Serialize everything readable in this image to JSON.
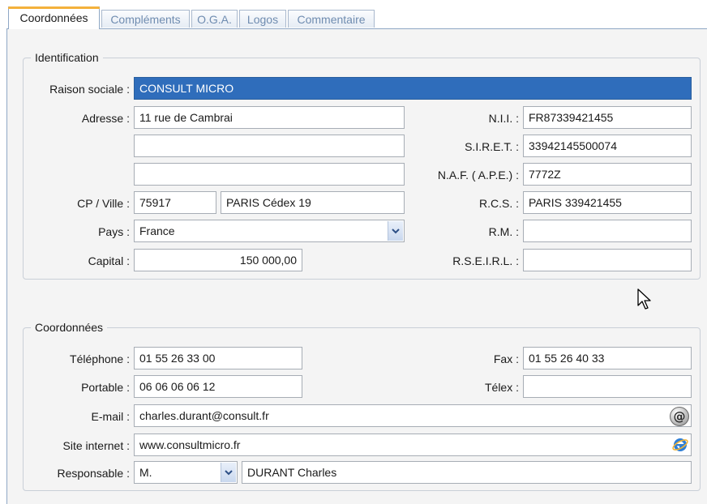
{
  "tabs": [
    {
      "label": "Coordonnées",
      "active": true
    },
    {
      "label": "Compléments",
      "active": false
    },
    {
      "label": "O.G.A.",
      "active": false
    },
    {
      "label": "Logos",
      "active": false
    },
    {
      "label": "Commentaire",
      "active": false
    }
  ],
  "identification": {
    "legend": "Identification",
    "raison_sociale": {
      "label": "Raison sociale :",
      "value": "CONSULT MICRO"
    },
    "adresse": {
      "label": "Adresse :",
      "line1": "11 rue de Cambrai",
      "line2": "",
      "line3": ""
    },
    "cp_ville": {
      "label": "CP / Ville :",
      "cp": "75917",
      "ville": "PARIS Cédex 19"
    },
    "pays": {
      "label": "Pays :",
      "value": "France"
    },
    "capital": {
      "label": "Capital :",
      "value": "150 000,00"
    },
    "nii": {
      "label": "N.I.I. :",
      "value": "FR87339421455"
    },
    "siret": {
      "label": "S.I.R.E.T. :",
      "value": "33942145500074"
    },
    "naf": {
      "label": "N.A.F. ( A.P.E.) :",
      "value": "7772Z"
    },
    "rcs": {
      "label": "R.C.S. :",
      "value": "PARIS 339421455"
    },
    "rm": {
      "label": "R.M. :",
      "value": ""
    },
    "rseirl": {
      "label": "R.S.E.I.R.L. :",
      "value": ""
    }
  },
  "coordonnees": {
    "legend": "Coordonnées",
    "telephone": {
      "label": "Téléphone :",
      "value": "01 55 26 33 00"
    },
    "portable": {
      "label": "Portable :",
      "value": "06 06 06 06 12"
    },
    "fax": {
      "label": "Fax :",
      "value": "01 55 26 40 33"
    },
    "telex": {
      "label": "Télex :",
      "value": ""
    },
    "email": {
      "label": "E-mail :",
      "value": "charles.durant@consult.fr"
    },
    "site": {
      "label": "Site internet :",
      "value": "www.consultmicro.fr"
    },
    "responsable": {
      "label": "Responsable :",
      "civilite": "M.",
      "nom": "DURANT Charles"
    }
  },
  "icons": {
    "email_button": "at-sign-icon",
    "site_button": "internet-explorer-icon",
    "dropdown": "chevron-down-icon",
    "cursor": "mouse-pointer-icon"
  },
  "colors": {
    "selection": "#2f6dbb",
    "active_tab_accent": "#f4b13b",
    "panel_bg": "#f4f4f4"
  }
}
